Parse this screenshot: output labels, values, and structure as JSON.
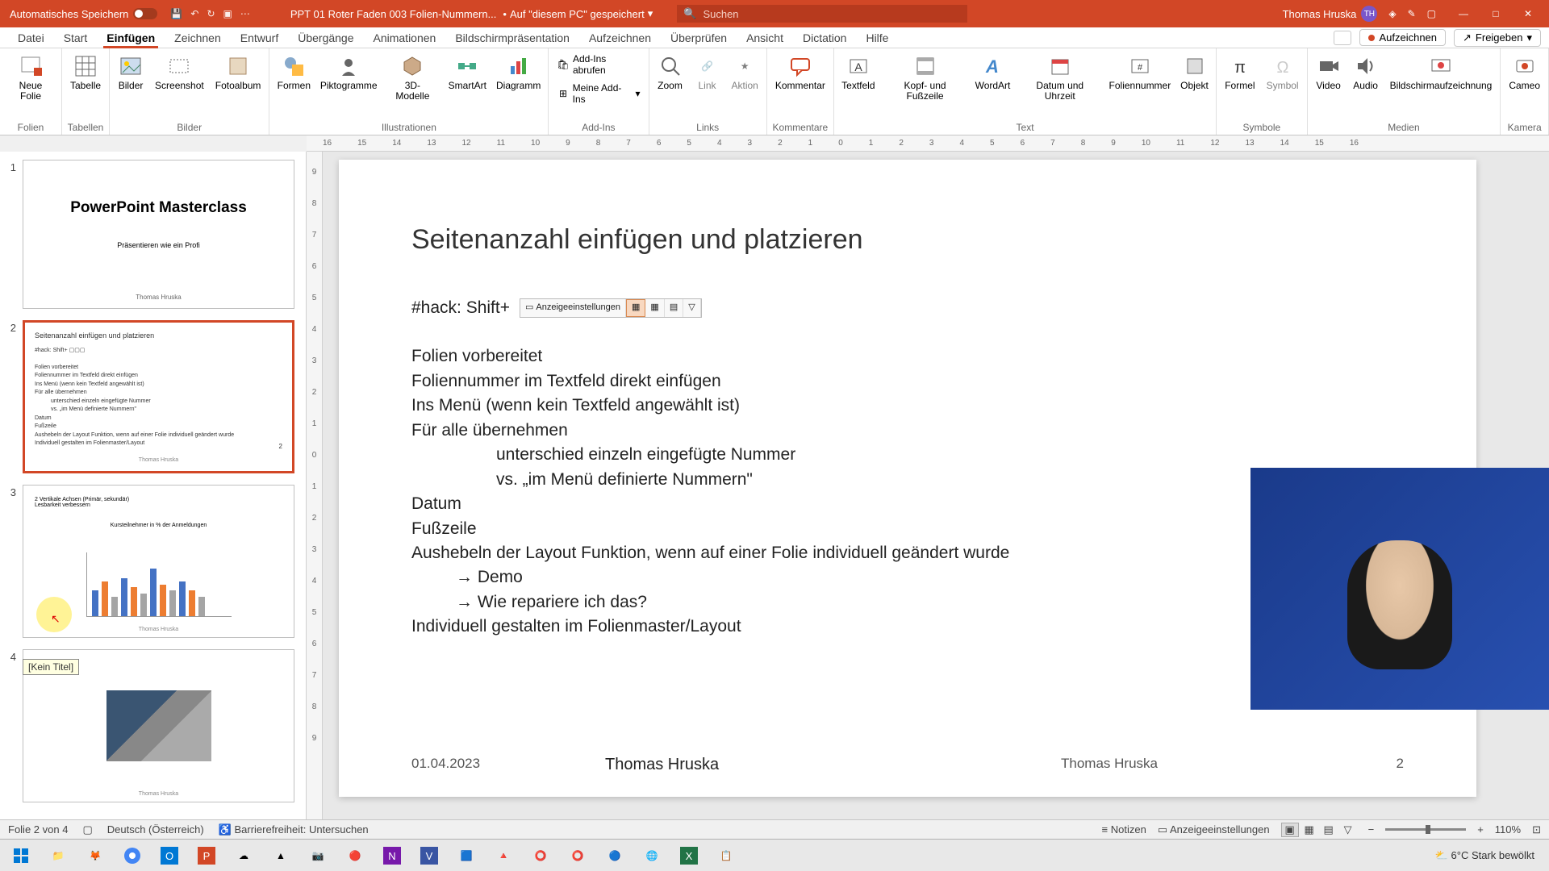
{
  "titlebar": {
    "autosave": "Automatisches Speichern",
    "doc_title": "PPT 01 Roter Faden 003 Folien-Nummern...",
    "saved_location": "Auf \"diesem PC\" gespeichert",
    "search_placeholder": "Suchen",
    "user_name": "Thomas Hruska",
    "user_initials": "TH"
  },
  "tabs": {
    "datei": "Datei",
    "start": "Start",
    "einfuegen": "Einfügen",
    "zeichnen": "Zeichnen",
    "entwurf": "Entwurf",
    "uebergaenge": "Übergänge",
    "animationen": "Animationen",
    "bildschirm": "Bildschirmpräsentation",
    "aufzeichnen_tab": "Aufzeichnen",
    "ueberpruefen": "Überprüfen",
    "ansicht": "Ansicht",
    "dictation": "Dictation",
    "hilfe": "Hilfe",
    "aufzeichnen_btn": "Aufzeichnen",
    "freigeben": "Freigeben"
  },
  "ribbon": {
    "neue_folie": "Neue\nFolie",
    "tabelle": "Tabelle",
    "bilder": "Bilder",
    "screenshot": "Screenshot",
    "fotoalbum": "Fotoalbum",
    "formen": "Formen",
    "piktogramme": "Piktogramme",
    "modelle": "3D-\nModelle",
    "smartart": "SmartArt",
    "diagramm": "Diagramm",
    "addins_abrufen": "Add-Ins abrufen",
    "meine_addins": "Meine Add-Ins",
    "zoom": "Zoom",
    "link": "Link",
    "aktion": "Aktion",
    "kommentar": "Kommentar",
    "textfeld": "Textfeld",
    "kopf_fuss": "Kopf- und\nFußzeile",
    "wordart": "WordArt",
    "datum_uhrzeit": "Datum und\nUhrzeit",
    "foliennummer": "Foliennummer",
    "objekt": "Objekt",
    "formel": "Formel",
    "symbol": "Symbol",
    "video": "Video",
    "audio": "Audio",
    "bildschirmaufz": "Bildschirmaufzeichnung",
    "cameo": "Cameo",
    "grp_folien": "Folien",
    "grp_tabellen": "Tabellen",
    "grp_bilder": "Bilder",
    "grp_illustrationen": "Illustrationen",
    "grp_addins": "Add-Ins",
    "grp_links": "Links",
    "grp_kommentare": "Kommentare",
    "grp_text": "Text",
    "grp_symbole": "Symbole",
    "grp_medien": "Medien",
    "grp_kamera": "Kamera"
  },
  "thumbs": {
    "n1": "1",
    "n2": "2",
    "n3": "3",
    "n4": "4",
    "t1_title": "PowerPoint Masterclass",
    "t1_sub": "Präsentieren wie ein Profi",
    "t1_author": "Thomas Hruska",
    "t2_title": "Seitenanzahl einfügen und platzieren",
    "tooltip": "[Kein Titel]"
  },
  "slide": {
    "title": "Seitenanzahl einfügen und platzieren",
    "hack": "#hack: Shift+",
    "mt_anzeige": "Anzeigeeinstellungen",
    "l1": "Folien vorbereitet",
    "l2": "Foliennummer im Textfeld direkt einfügen",
    "l3": "Ins Menü (wenn kein Textfeld angewählt ist)",
    "l4": "Für alle übernehmen",
    "l5": "unterschied  einzeln eingefügte Nummer",
    "l6": "vs. „im Menü definierte Nummern\"",
    "l7": "Datum",
    "l8": "Fußzeile",
    "l9": "Aushebeln der Layout Funktion, wenn auf einer Folie individuell geändert wurde",
    "l10": "→ Demo",
    "l11": "→ Wie repariere ich das?",
    "l12": "Individuell gestalten im Folienmaster/Layout",
    "page_num": "2",
    "footer_date": "01.04.2023",
    "footer_author_big": "Thomas Hruska",
    "footer_author": "Thomas Hruska",
    "footer_num": "2"
  },
  "statusbar": {
    "slide_of": "Folie 2 von 4",
    "language": "Deutsch (Österreich)",
    "accessibility": "Barrierefreiheit: Untersuchen",
    "notizen": "Notizen",
    "anzeige": "Anzeigeeinstellungen",
    "zoom": "110%"
  },
  "taskbar": {
    "weather": "6°C  Stark bewölkt"
  }
}
